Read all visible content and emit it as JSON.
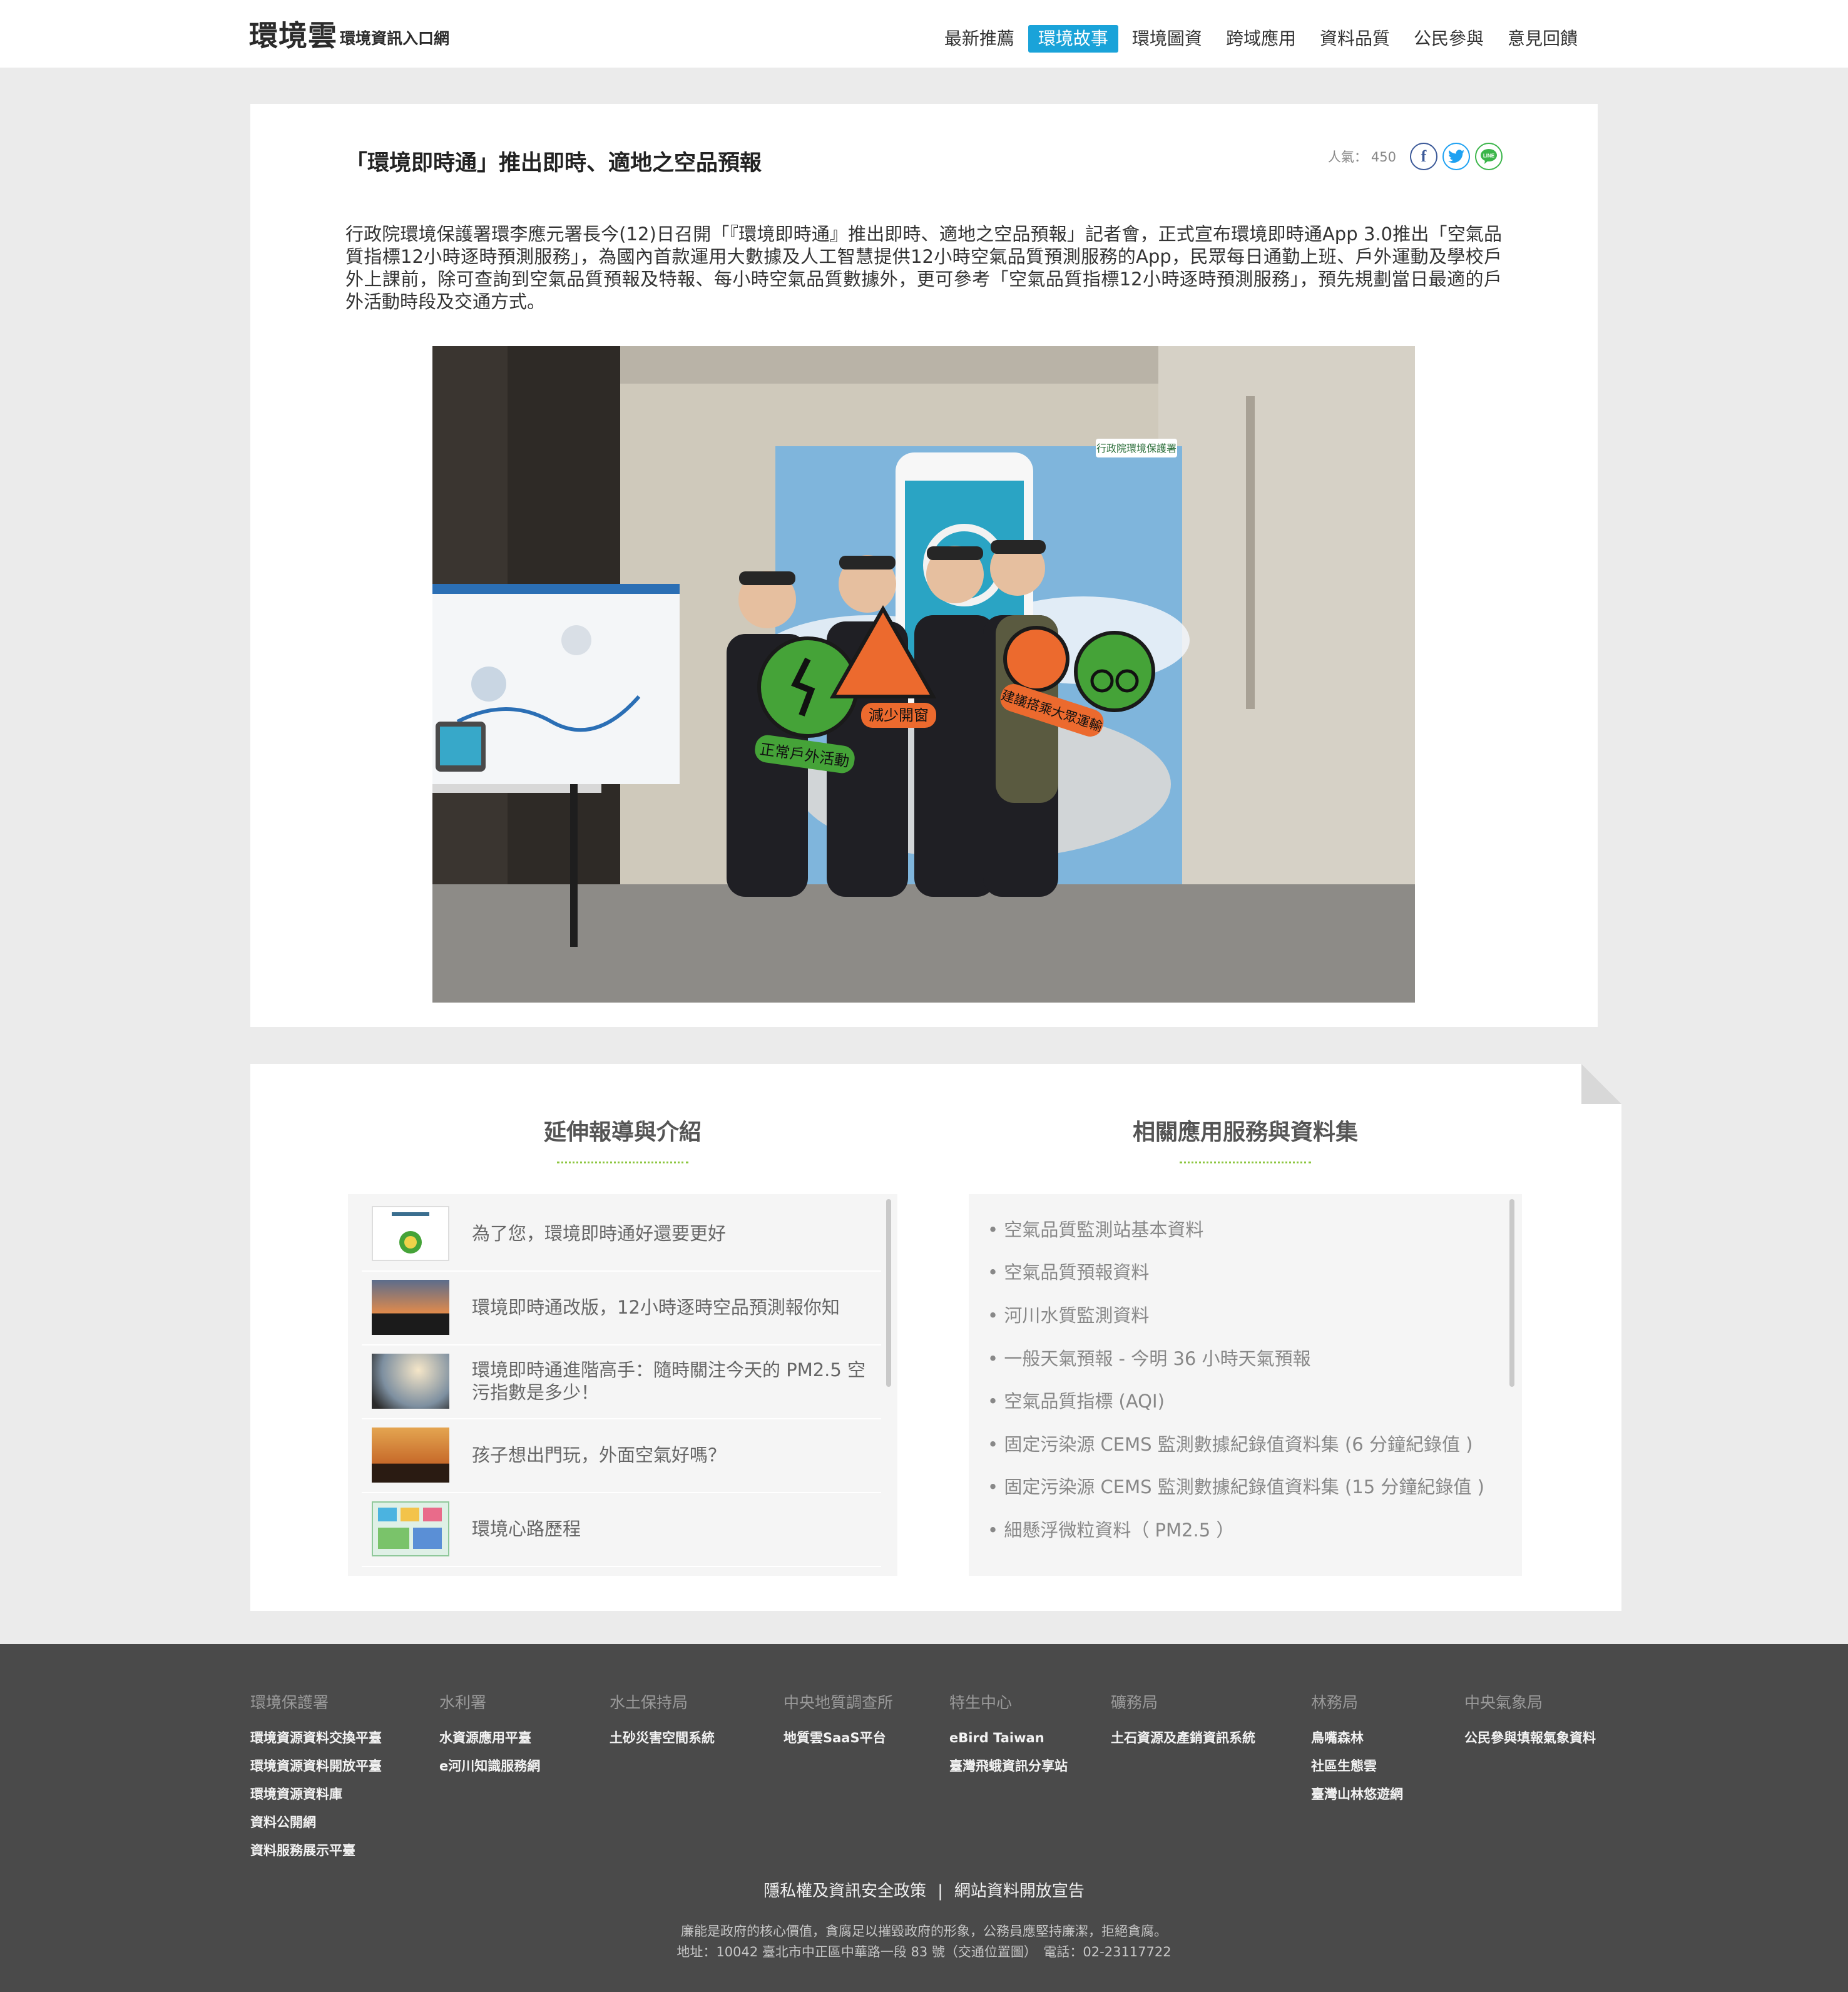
{
  "header": {
    "logo_main": "環境雲",
    "logo_sub": "環境資訊入口網",
    "nav": [
      "最新推薦",
      "環境故事",
      "環境圖資",
      "跨域應用",
      "資料品質",
      "公民參與",
      "意見回饋"
    ],
    "active_nav": "環境故事"
  },
  "article": {
    "title": "「環境即時通」推出即時、適地之空品預報",
    "popularity_label": "人氣：",
    "popularity_value": "450",
    "body": "行政院環境保護署環李應元署長今(12)日召開「『環境即時通』推出即時、適地之空品預報」記者會，正式宣布環境即時通App 3.0推出「空氣品質指標12小時逐時預測服務」，為國內首款運用大數據及人工智慧提供12小時空氣品質預測服務的App，民眾每日通勤上班、戶外運動及學校戶外上課前，除可查詢到空氣品質預報及特報、每小時空氣品質數據外，更可參考「空氣品質指標12小時逐時預測服務」，預先規劃當日最適的戶外活動時段及交通方式。",
    "photo_signs": [
      "正常戶外活動",
      "減少開窗",
      "建議搭乘大眾運輸"
    ],
    "photo_banner": "行政院環境保護署"
  },
  "related": {
    "left_title": "延伸報導與介紹",
    "right_title": "相關應用服務與資料集",
    "stories": [
      "為了您，環境即時通好還要更好",
      "環境即時通改版，12小時逐時空品預測報你知",
      "環境即時通進階高手：隨時關注今天的 PM2.5 空污指數是多少！",
      "孩子想出門玩，外面空氣好嗎？",
      "環境心路歷程"
    ],
    "datasets": [
      "• 空氣品質監測站基本資料",
      "• 空氣品質預報資料",
      "• 河川水質監測資料",
      "• 一般天氣預報 - 今明 36 小時天氣預報",
      "• 空氣品質指標 (AQI)",
      "• 固定污染源 CEMS 監測數據紀錄值資料集 (6 分鐘紀錄值 )",
      "• 固定污染源 CEMS 監測數據紀錄值資料集 (15 分鐘紀錄值 )",
      "• 細懸浮微粒資料（ PM2.5 ）"
    ]
  },
  "footer": {
    "columns": [
      {
        "head": "環境保護署",
        "links": [
          "環境資源資料交換平臺",
          "環境資源資料開放平臺",
          "環境資源資料庫",
          "資料公開網",
          "資料服務展示平臺"
        ]
      },
      {
        "head": "水利署",
        "links": [
          "水資源應用平臺",
          "e河川知識服務網"
        ]
      },
      {
        "head": "水土保持局",
        "links": [
          "土砂災害空間系統"
        ]
      },
      {
        "head": "中央地質調查所",
        "links": [
          "地質雲SaaS平台"
        ]
      },
      {
        "head": "特生中心",
        "links": [
          "eBird Taiwan",
          "臺灣飛蛾資訊分享站"
        ]
      },
      {
        "head": "礦務局",
        "links": [
          "土石資源及產銷資訊系統"
        ]
      },
      {
        "head": "林務局",
        "links": [
          "鳥嘴森林",
          "社區生態雲",
          "臺灣山林悠遊網"
        ]
      },
      {
        "head": "中央氣象局",
        "links": [
          "公民參與填報氣象資料"
        ]
      }
    ],
    "privacy": "隱私權及資訊安全政策",
    "separator": "|",
    "open_data": "網站資料開放宣告",
    "notice_line1": "廉能是政府的核心價值，貪腐足以摧毀政府的形象，公務員應堅持廉潔，拒絕貪腐。",
    "notice_line2": "地址：10042 臺北市中正區中華路一段 83 號（交通位置圖）　電話：02-23117722"
  },
  "colors": {
    "accent": "#1aa3d9",
    "page_bg": "#ebebeb",
    "footer_bg": "#4a4a4a",
    "green_underline": "#8cc63f"
  }
}
